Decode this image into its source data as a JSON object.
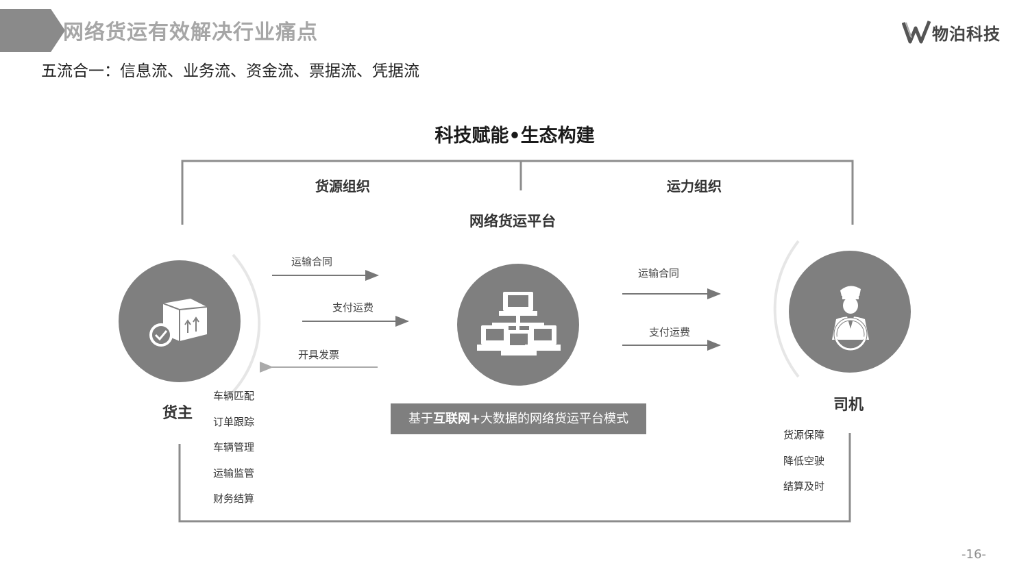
{
  "header": {
    "title": "网络货运有效解决行业痛点",
    "subtitle": "五流合一：信息流、业务流、资金流、票据流、凭据流",
    "logo_text": "物泊科技"
  },
  "diagram": {
    "title": "科技赋能•生态构建",
    "left_section": "货源组织",
    "right_section": "运力组织",
    "platform_label": "网络货运平台",
    "shipper": {
      "label": "货主",
      "functions": [
        "车辆匹配",
        "订单跟踪",
        "车辆管理",
        "运输监管",
        "财务结算"
      ]
    },
    "driver": {
      "label": "司机",
      "benefits": [
        "货源保障",
        "降低空驶",
        "结算及时"
      ]
    },
    "left_flows": [
      "运输合同",
      "支付运费",
      "开具发票"
    ],
    "right_flows": [
      "运输合同",
      "支付运费"
    ],
    "banner": {
      "prefix": "基于",
      "bold": "互联网+",
      "suffix": "大数据的网络货运平台模式"
    }
  },
  "page_number": "-16-",
  "colors": {
    "circle_fill": "#7f7f7f",
    "line": "#8c8c8c",
    "banner_bg": "#7f7f7f",
    "title_gray": "#a6a6a6"
  },
  "icons": [
    "package-check-icon",
    "network-computers-icon",
    "driver-steering-wheel-icon",
    "company-logo-icon"
  ]
}
